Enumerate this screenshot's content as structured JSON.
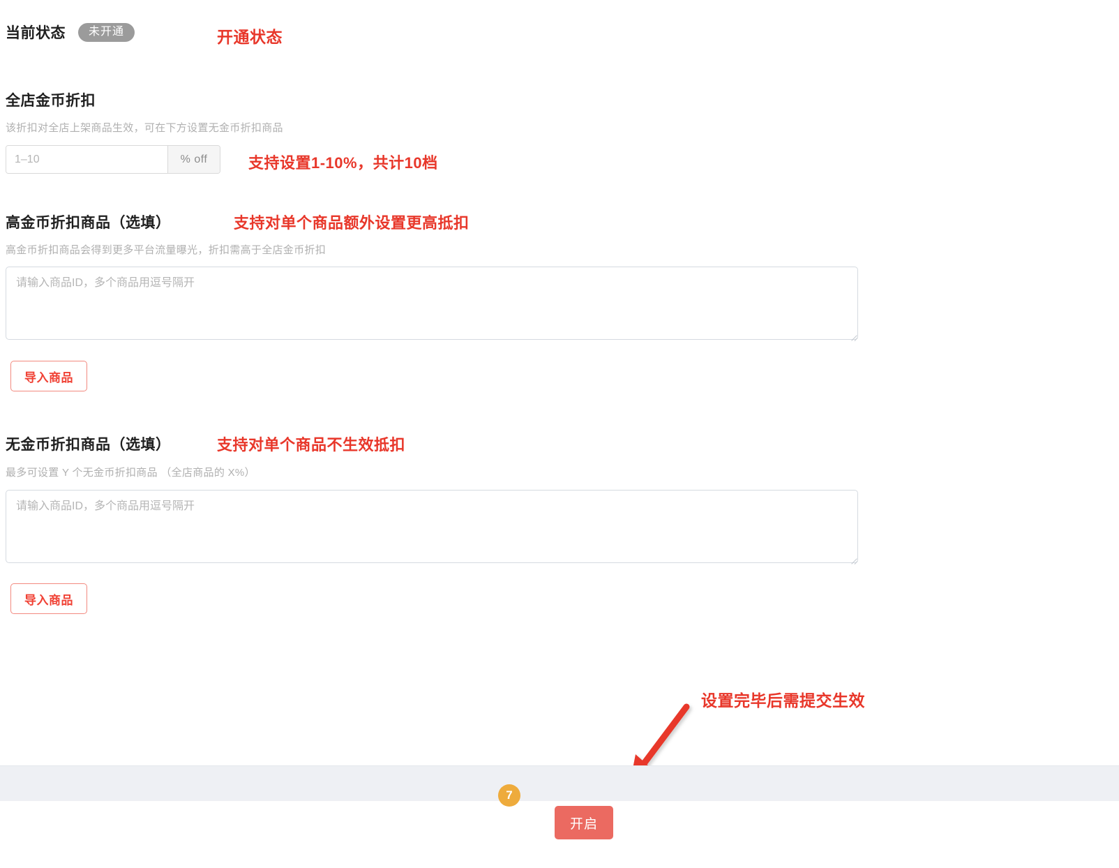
{
  "status": {
    "label": "当前状态",
    "badge_text": "未开通",
    "badge_color": "#9b9b9b",
    "annotation": "开通状态"
  },
  "store_discount": {
    "title": "全店金币折扣",
    "description": "该折扣对全店上架商品生效，可在下方设置无金币折扣商品",
    "input_placeholder": "1–10",
    "input_value": "",
    "addon_label": "% off",
    "annotation": "支持设置1-10%，共计10档"
  },
  "high_discount": {
    "title": "高金币折扣商品（选填）",
    "description": "高金币折扣商品会得到更多平台流量曝光，折扣需高于全店金币折扣",
    "textarea_placeholder": "请输入商品ID，多个商品用逗号隔开",
    "textarea_value": "",
    "import_button": "导入商品",
    "annotation": "支持对单个商品额外设置更高抵扣"
  },
  "no_discount": {
    "title": "无金币折扣商品（选填）",
    "description": "最多可设置 Y 个无金币折扣商品 （全店商品的 X%）",
    "textarea_placeholder": "请输入商品ID，多个商品用逗号隔开",
    "textarea_value": "",
    "import_button": "导入商品",
    "annotation": "支持对单个商品不生效抵扣"
  },
  "footer": {
    "annotation": "设置完毕后需提交生效",
    "step_number": "7",
    "submit_label": "开启",
    "submit_color": "#eb6a61",
    "step_badge_color": "#eeab3c"
  },
  "theme": {
    "annotation_red": "#e8372a",
    "arrow_red": "#e8372a",
    "link_red": "#f04134",
    "muted_text": "#b0b0b0"
  }
}
